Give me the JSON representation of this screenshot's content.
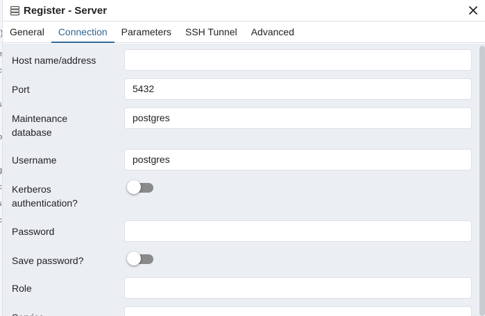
{
  "dialog": {
    "title": "Register - Server",
    "icons": {
      "title": "server-icon",
      "close": "close-icon"
    }
  },
  "tabs": [
    {
      "label": "General",
      "active": false
    },
    {
      "label": "Connection",
      "active": true
    },
    {
      "label": "Parameters",
      "active": false
    },
    {
      "label": "SSH Tunnel",
      "active": false
    },
    {
      "label": "Advanced",
      "active": false
    }
  ],
  "fields": {
    "host": {
      "label": "Host name/address",
      "value": ""
    },
    "port": {
      "label": "Port",
      "value": "5432"
    },
    "maintenance_db": {
      "label": "Maintenance database",
      "value": "postgres"
    },
    "username": {
      "label": "Username",
      "value": "postgres"
    },
    "kerberos": {
      "label": "Kerberos authentication?",
      "checked": false
    },
    "password": {
      "label": "Password",
      "value": ""
    },
    "save_password": {
      "label": "Save password?",
      "checked": false
    },
    "role": {
      "label": "Role",
      "value": ""
    },
    "service": {
      "label": "Service",
      "value": ""
    }
  },
  "colors": {
    "accent": "#326690",
    "panel_bg": "#ebeef3",
    "toggle_off": "#8a8a8a"
  }
}
